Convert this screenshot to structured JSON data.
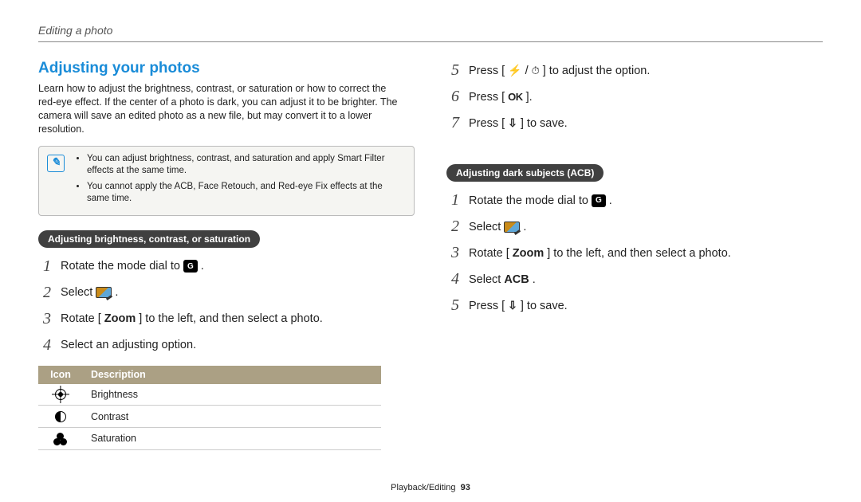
{
  "breadcrumb": "Editing a photo",
  "section_title": "Adjusting your photos",
  "intro": "Learn how to adjust the brightness, contrast, or saturation or how to correct the red-eye effect. If the center of a photo is dark, you can adjust it to be brighter. The camera will save an edited photo as a new file, but may convert it to a lower resolution.",
  "notes": {
    "n1": "You can adjust brightness, contrast, and saturation and apply Smart Filter effects at the same time.",
    "n2": "You cannot apply the ACB, Face Retouch, and Red-eye Fix effects at the same time."
  },
  "pill1": "Adjusting brightness, contrast, or saturation",
  "left_steps": {
    "s1": {
      "num": "1",
      "t1": "Rotate the mode dial to ",
      "t2": "."
    },
    "s2": {
      "num": "2",
      "t1": "Select ",
      "t2": "."
    },
    "s3": {
      "num": "3",
      "t1": "Rotate [",
      "b": "Zoom",
      "t2": "] to the left, and then select a photo."
    },
    "s4": {
      "num": "4",
      "t1": "Select an adjusting option."
    }
  },
  "table": {
    "h1": "Icon",
    "h2": "Description",
    "r1": "Brightness",
    "r2": "Contrast",
    "r3": "Saturation"
  },
  "right_top": {
    "s5": {
      "num": "5",
      "t1": "Press [",
      "t2": "/",
      "t3": "] to adjust the option."
    },
    "s6": {
      "num": "6",
      "t1": "Press [",
      "t2": "]."
    },
    "s7": {
      "num": "7",
      "t1": "Press [",
      "t2": "] to save."
    }
  },
  "pill2": "Adjusting dark subjects (ACB)",
  "right_steps": {
    "s1": {
      "num": "1",
      "t1": "Rotate the mode dial to ",
      "t2": "."
    },
    "s2": {
      "num": "2",
      "t1": "Select ",
      "t2": "."
    },
    "s3": {
      "num": "3",
      "t1": "Rotate [",
      "b": "Zoom",
      "t2": "] to the left, and then select a photo."
    },
    "s4": {
      "num": "4",
      "t1": "Select ",
      "b": "ACB",
      "t2": "."
    },
    "s5": {
      "num": "5",
      "t1": "Press [",
      "t2": "] to save."
    }
  },
  "ok_label": "OK",
  "footer": {
    "section": "Playback/Editing",
    "page": "93"
  }
}
